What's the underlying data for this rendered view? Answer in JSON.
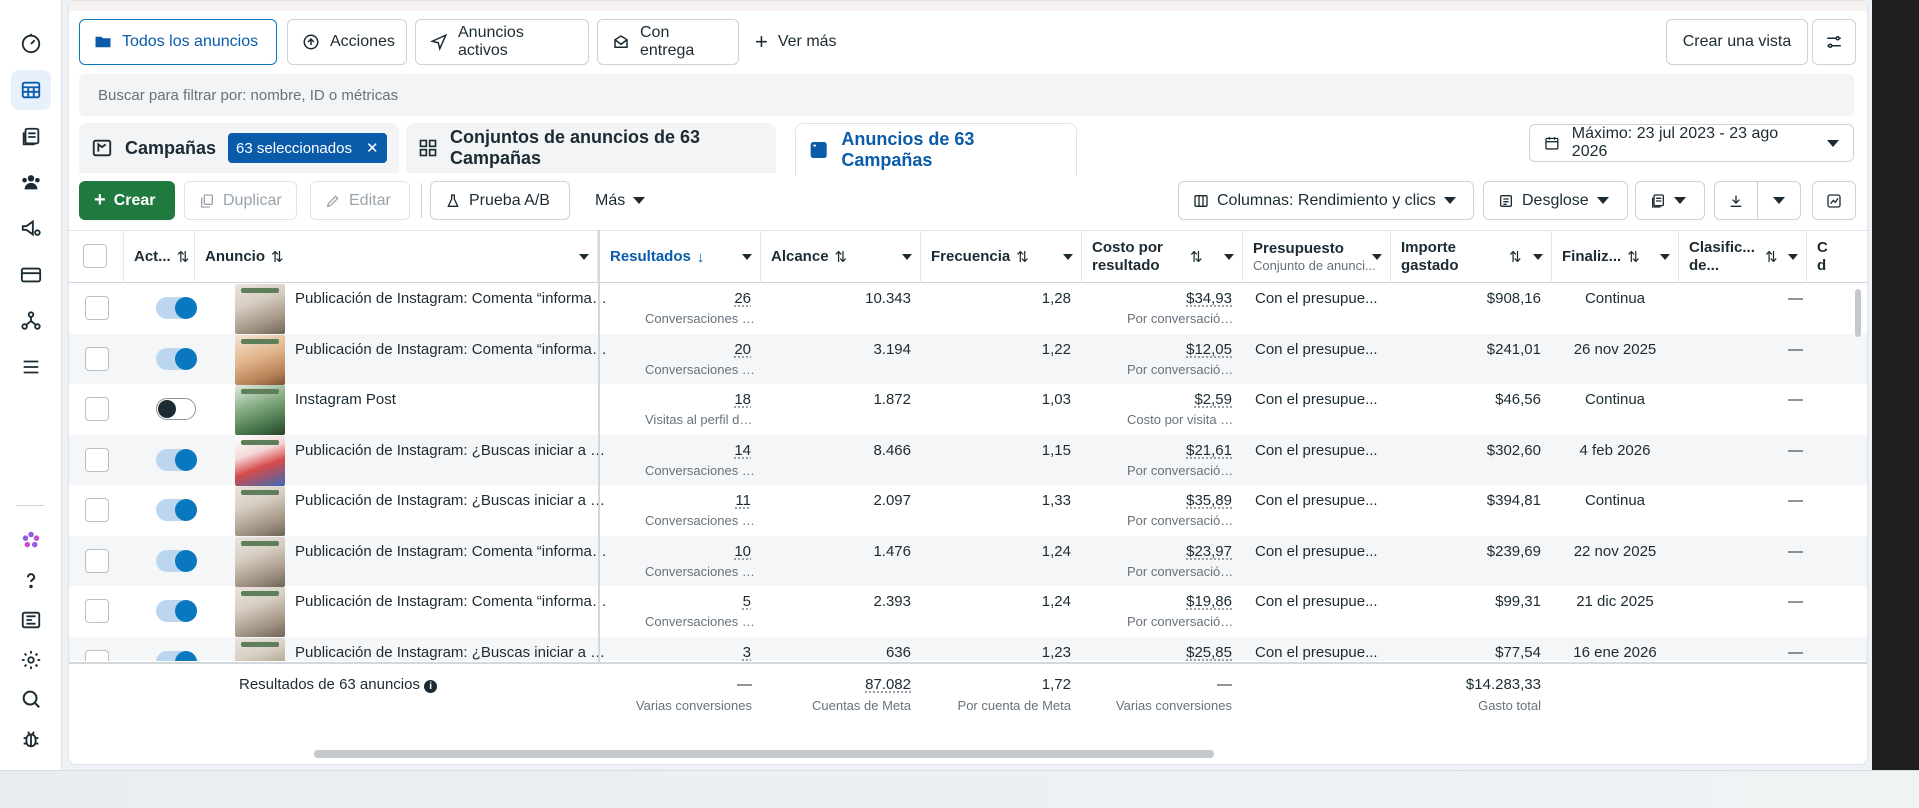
{
  "filter_bar": {
    "views": [
      "Todos los anuncios",
      "Acciones",
      "Anuncios activos",
      "Con entrega"
    ],
    "more_label": "Ver más",
    "create_view_label": "Crear una vista"
  },
  "search": {
    "placeholder": "Buscar para filtrar por: nombre, ID o métricas"
  },
  "levels": {
    "campaigns": "Campañas",
    "selected_badge": "63 seleccionados",
    "adsets": "Conjuntos de anuncios de 63 Campañas",
    "ads": "Anuncios de 63 Campañas"
  },
  "date_range": "Máximo: 23 jul 2023 - 23 ago 2026",
  "toolbar": {
    "create": "Crear",
    "duplicate": "Duplicar",
    "edit": "Editar",
    "ab_test": "Prueba A/B",
    "more": "Más",
    "columns": "Columnas: Rendimiento y clics",
    "breakdown": "Desglose"
  },
  "table": {
    "headers": {
      "active": "Act...",
      "ad": "Anuncio",
      "results": "Resultados",
      "reach": "Alcance",
      "frequency": "Frecuencia",
      "cost_per_result": "Costo por resultado",
      "budget": "Presupuesto",
      "budget_sub": "Conjunto de anunci...",
      "amount_spent": "Importe gastado",
      "ends": "Finaliz...",
      "ranking": "Clasific... de...",
      "next": "C d"
    },
    "rows": [
      {
        "on": true,
        "name": "Publicación de Instagram: Comenta “información” y recibe detalles",
        "results": "26",
        "results_sub": "Conversaciones con ...",
        "reach": "10.343",
        "freq": "1,28",
        "cpr": "$34,93",
        "cpr_sub": "Por conversación con...",
        "budget": "Con el presupue...",
        "spent": "$908,16",
        "ends": "Continua",
        "rank": "—",
        "thumb": "t1"
      },
      {
        "on": true,
        "name": "Publicación de Instagram: Comenta “información” y recibe detalles",
        "results": "20",
        "results_sub": "Conversaciones con ...",
        "reach": "3.194",
        "freq": "1,22",
        "cpr": "$12,05",
        "cpr_sub": "Por conversación con...",
        "budget": "Con el presupue...",
        "spent": "$241,01",
        "ends": "26 nov 2025",
        "rank": "—",
        "thumb": "t2"
      },
      {
        "on": false,
        "name": "Instagram Post",
        "results": "18",
        "results_sub": "Visitas al perfil de Inst...",
        "reach": "1.872",
        "freq": "1,03",
        "cpr": "$2,59",
        "cpr_sub": "Costo por visita al per...",
        "budget": "Con el presupue...",
        "spent": "$46,56",
        "ends": "Continua",
        "rank": "—",
        "thumb": "t3"
      },
      {
        "on": true,
        "name": "Publicación de Instagram: ¿Buscas iniciar a vender?",
        "results": "14",
        "results_sub": "Conversaciones con ...",
        "reach": "8.466",
        "freq": "1,15",
        "cpr": "$21,61",
        "cpr_sub": "Por conversación con...",
        "budget": "Con el presupue...",
        "spent": "$302,60",
        "ends": "4 feb 2026",
        "rank": "—",
        "thumb": "t4"
      },
      {
        "on": true,
        "name": "Publicación de Instagram: ¿Buscas iniciar a vender?",
        "results": "11",
        "results_sub": "Conversaciones con ...",
        "reach": "2.097",
        "freq": "1,33",
        "cpr": "$35,89",
        "cpr_sub": "Por conversación con...",
        "budget": "Con el presupue...",
        "spent": "$394,81",
        "ends": "Continua",
        "rank": "—",
        "thumb": "t1"
      },
      {
        "on": true,
        "name": "Publicación de Instagram: Comenta “información” y recibe detalles",
        "results": "10",
        "results_sub": "Conversaciones con ...",
        "reach": "1.476",
        "freq": "1,24",
        "cpr": "$23,97",
        "cpr_sub": "Por conversación con...",
        "budget": "Con el presupue...",
        "spent": "$239,69",
        "ends": "22 nov 2025",
        "rank": "—",
        "thumb": "t1"
      },
      {
        "on": true,
        "name": "Publicación de Instagram: Comenta “información” y recibe detalles",
        "results": "5",
        "results_sub": "Conversaciones con ...",
        "reach": "2.393",
        "freq": "1,24",
        "cpr": "$19,86",
        "cpr_sub": "Por conversación con...",
        "budget": "Con el presupue...",
        "spent": "$99,31",
        "ends": "21 dic 2025",
        "rank": "—",
        "thumb": "t1"
      },
      {
        "on": true,
        "name": "Publicación de Instagram: ¿Buscas iniciar a vender?",
        "results": "3",
        "results_sub": "Conversaciones con ...",
        "reach": "636",
        "freq": "1,23",
        "cpr": "$25,85",
        "cpr_sub": "Por conversación con...",
        "budget": "Con el presupue...",
        "spent": "$77,54",
        "ends": "16 ene 2026",
        "rank": "—",
        "thumb": "t1"
      }
    ],
    "footer": {
      "label": "Resultados de 63 anuncios",
      "results": "—",
      "results_sub": "Varias conversiones",
      "reach": "87.082",
      "reach_sub": "Cuentas de Meta",
      "freq": "1,72",
      "freq_sub": "Por cuenta de Meta",
      "cpr": "—",
      "cpr_sub": "Varias conversiones",
      "spent": "$14.283,33",
      "spent_sub": "Gasto total"
    }
  },
  "colors": {
    "accent": "#0a78be",
    "create_green": "#1e7a3e"
  }
}
